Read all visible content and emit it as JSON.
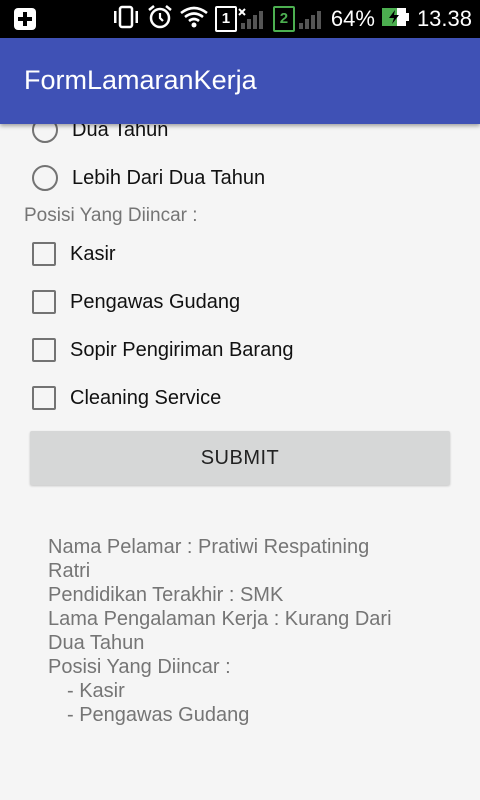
{
  "status_bar": {
    "battery": "64%",
    "time": "13.38",
    "sim1": "1",
    "sim2": "2"
  },
  "app": {
    "title": "FormLamaranKerja"
  },
  "experience_options": [
    {
      "label": "Dua Tahun",
      "selected": false
    },
    {
      "label": "Lebih Dari Dua Tahun",
      "selected": false
    }
  ],
  "position_section": {
    "label": "Posisi Yang Diincar :",
    "options": [
      {
        "label": "Kasir",
        "checked": false
      },
      {
        "label": "Pengawas Gudang",
        "checked": false
      },
      {
        "label": "Sopir Pengiriman Barang",
        "checked": false
      },
      {
        "label": "Cleaning Service",
        "checked": false
      }
    ]
  },
  "submit_label": "SUBMIT",
  "result": {
    "lines": [
      "Nama Pelamar : Pratiwi Respatining",
      "Ratri",
      "Pendidikan Terakhir : SMK",
      "Lama Pengalaman Kerja : Kurang Dari",
      "Dua Tahun",
      "Posisi Yang Diincar :",
      "- Kasir",
      "- Pengawas Gudang"
    ]
  }
}
